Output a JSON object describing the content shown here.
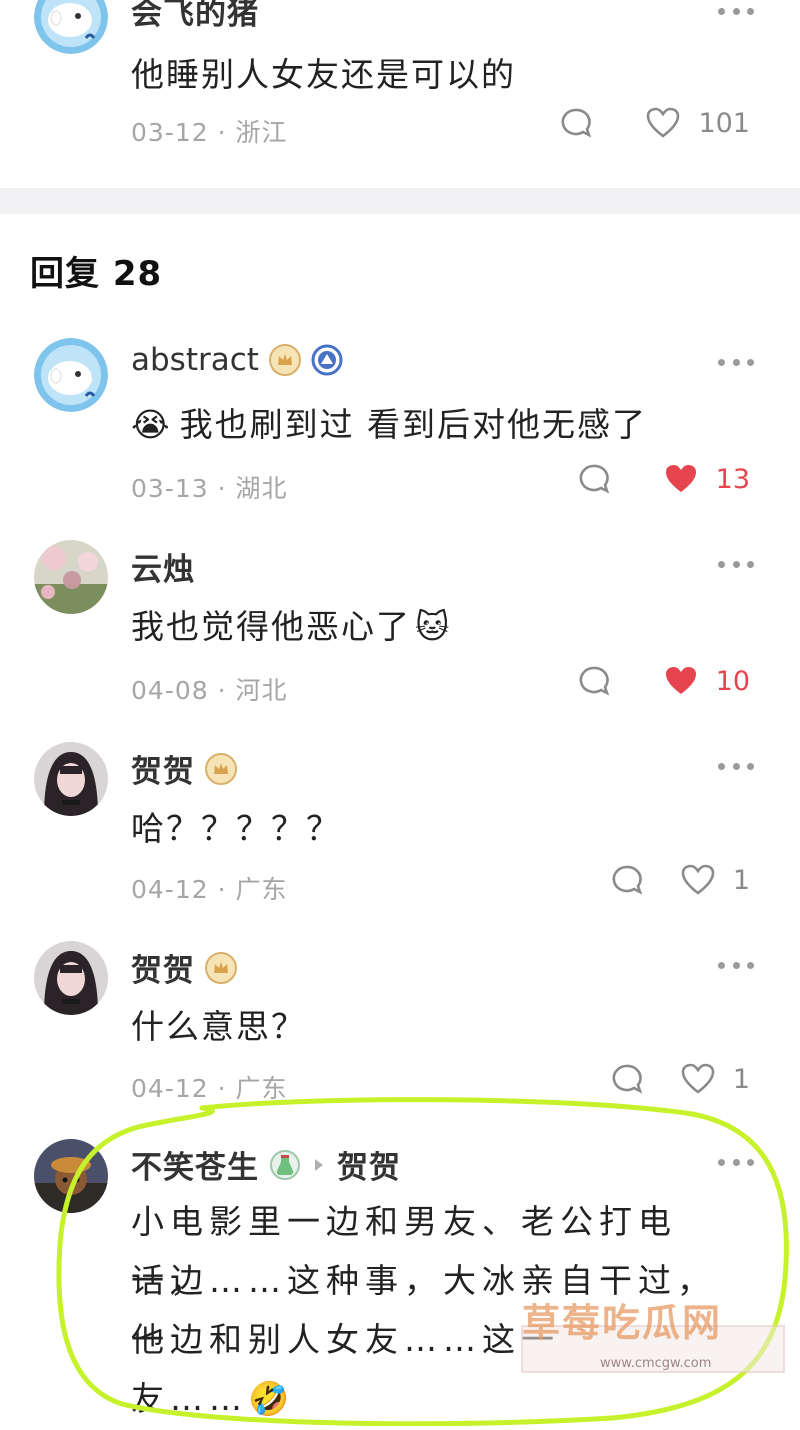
{
  "top_comment": {
    "name": "会飞的猪",
    "text": "他睡别人女友还是可以的",
    "meta": "03-12 · 浙江",
    "likes": "101"
  },
  "section": {
    "title": "回复 28"
  },
  "replies": [
    {
      "name": "abstract",
      "emoji": "😭",
      "text": "我也刷到过 看到后对他无感了",
      "meta": "03-13 · 湖北",
      "likes": "13",
      "liked": true
    },
    {
      "name": "云烛",
      "text": "我也觉得他恶心了",
      "emoji": "🐱",
      "meta": "04-08 · 河北",
      "likes": "10",
      "liked": true
    },
    {
      "name": "贺贺",
      "text": "哈？？？？？",
      "meta": "04-12 · 广东",
      "likes": "1",
      "liked": false
    },
    {
      "name": "贺贺",
      "text": "什么意思？",
      "meta": "04-12 · 广东",
      "likes": "1",
      "liked": false
    },
    {
      "name": "不笑苍生",
      "reply_to": "贺贺",
      "lines": [
        "小电影里一边和男友、老公打电话，",
        "一边……这种事，大冰亲自干过，他",
        "一边和别人女友……这一",
        "友……"
      ],
      "emoji": "🤣"
    }
  ],
  "watermark": {
    "text": "草莓吃瓜网",
    "url": "www.cmcgw.com"
  },
  "colors": {
    "like_red": "#e64550",
    "highlight": "#c6f22b",
    "meta_gray": "#a6a6a6"
  }
}
